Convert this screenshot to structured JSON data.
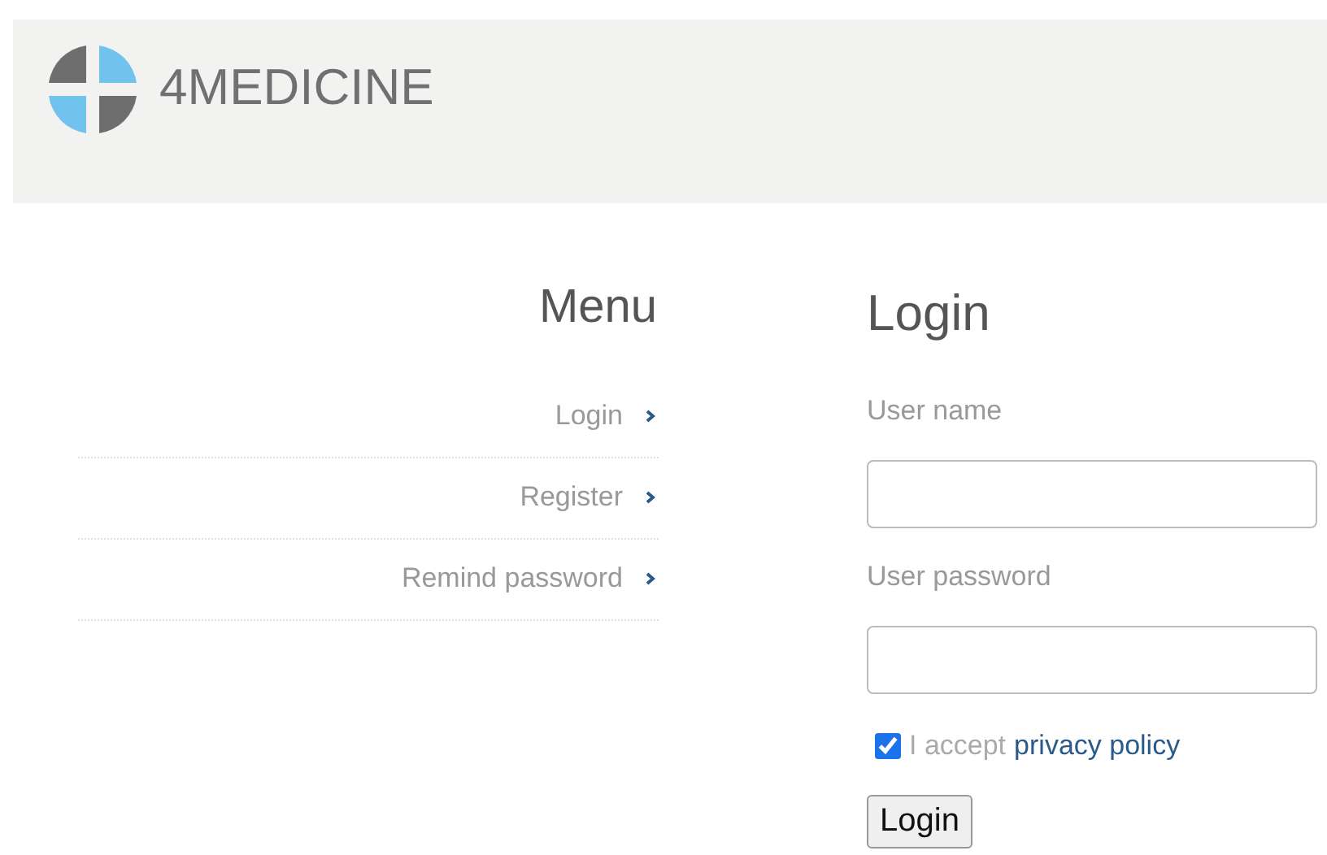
{
  "header": {
    "logo_text": "4MEDICINE"
  },
  "menu": {
    "title": "Menu",
    "items": [
      {
        "label": "Login"
      },
      {
        "label": "Register"
      },
      {
        "label": "Remind password"
      }
    ]
  },
  "login": {
    "title": "Login",
    "fields": [
      {
        "label": "User name"
      },
      {
        "label": "User password"
      }
    ],
    "consent": {
      "checked": true,
      "text": "I accept",
      "link": "privacy policy"
    },
    "button": "Login"
  }
}
